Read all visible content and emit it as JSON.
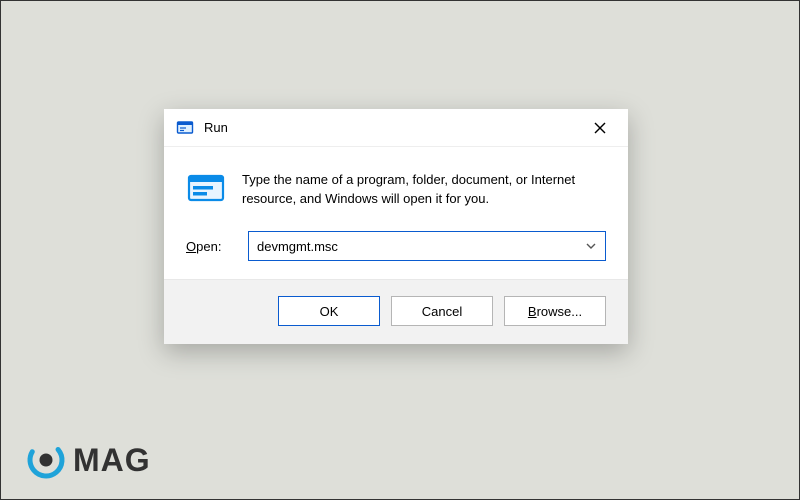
{
  "dialog": {
    "title": "Run",
    "description": "Type the name of a program, folder, document, or Internet resource, and Windows will open it for you.",
    "open_label_prefix": "O",
    "open_label_rest": "pen:",
    "input_value": "devmgmt.msc",
    "buttons": {
      "ok": "OK",
      "cancel": "Cancel",
      "browse_prefix": "B",
      "browse_rest": "rowse..."
    }
  },
  "watermark": {
    "text": "MAG"
  }
}
